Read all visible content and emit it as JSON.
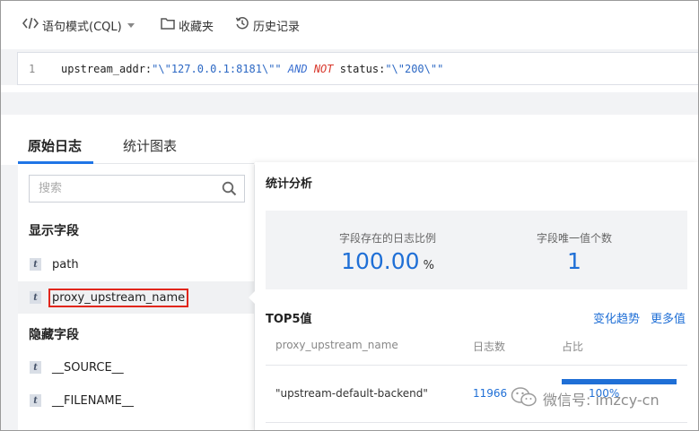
{
  "toolbar": {
    "mode_label": "语句模式(CQL)",
    "favorites_label": "收藏夹",
    "history_label": "历史记录"
  },
  "editor": {
    "line_number": "1",
    "tokens": {
      "t1": "upstream_addr:",
      "t2": "\"\\\"127.0.0.1:8181\\\"\"",
      "t3": "AND",
      "t4": "NOT",
      "t5": "status:",
      "t6": "\"\\\"200\\\"\""
    }
  },
  "tabs": [
    {
      "label": "原始日志",
      "active": true
    },
    {
      "label": "统计图表",
      "active": false
    }
  ],
  "left_panel": {
    "search_placeholder": "搜索",
    "shown_fields_title": "显示字段",
    "shown_fields": [
      {
        "type": "t",
        "name": "path",
        "selected": false
      },
      {
        "type": "t",
        "name": "proxy_upstream_name",
        "selected": true
      }
    ],
    "hidden_fields_title": "隐藏字段",
    "hidden_fields": [
      {
        "type": "t",
        "name": "__SOURCE__"
      },
      {
        "type": "t",
        "name": "__FILENAME__"
      }
    ]
  },
  "popup": {
    "title": "统计分析",
    "stats": {
      "ratio_label": "字段存在的日志比例",
      "ratio_value": "100.00",
      "ratio_unit": "%",
      "unique_label": "字段唯一值个数",
      "unique_value": "1"
    },
    "top5": {
      "title": "TOP5值",
      "trend_link": "变化趋势",
      "more_link": "更多值",
      "columns": [
        "proxy_upstream_name",
        "日志数",
        "占比"
      ],
      "rows": [
        {
          "value": "\"upstream-default-backend\"",
          "count": "11966",
          "percent": "100%",
          "fraction": 1.0
        }
      ]
    }
  },
  "watermark": {
    "text": "微信号: imzcy-cn"
  },
  "colors": {
    "accent": "#1f6fd6",
    "tab_underline": "#1f75e6",
    "highlight_border": "#e1261c",
    "keyword_not": "#d8362a"
  },
  "icons": {
    "mode": "code-brackets-icon",
    "favorites": "folder-icon",
    "history": "history-icon",
    "search": "search-icon",
    "watermark": "wechat-icon"
  }
}
